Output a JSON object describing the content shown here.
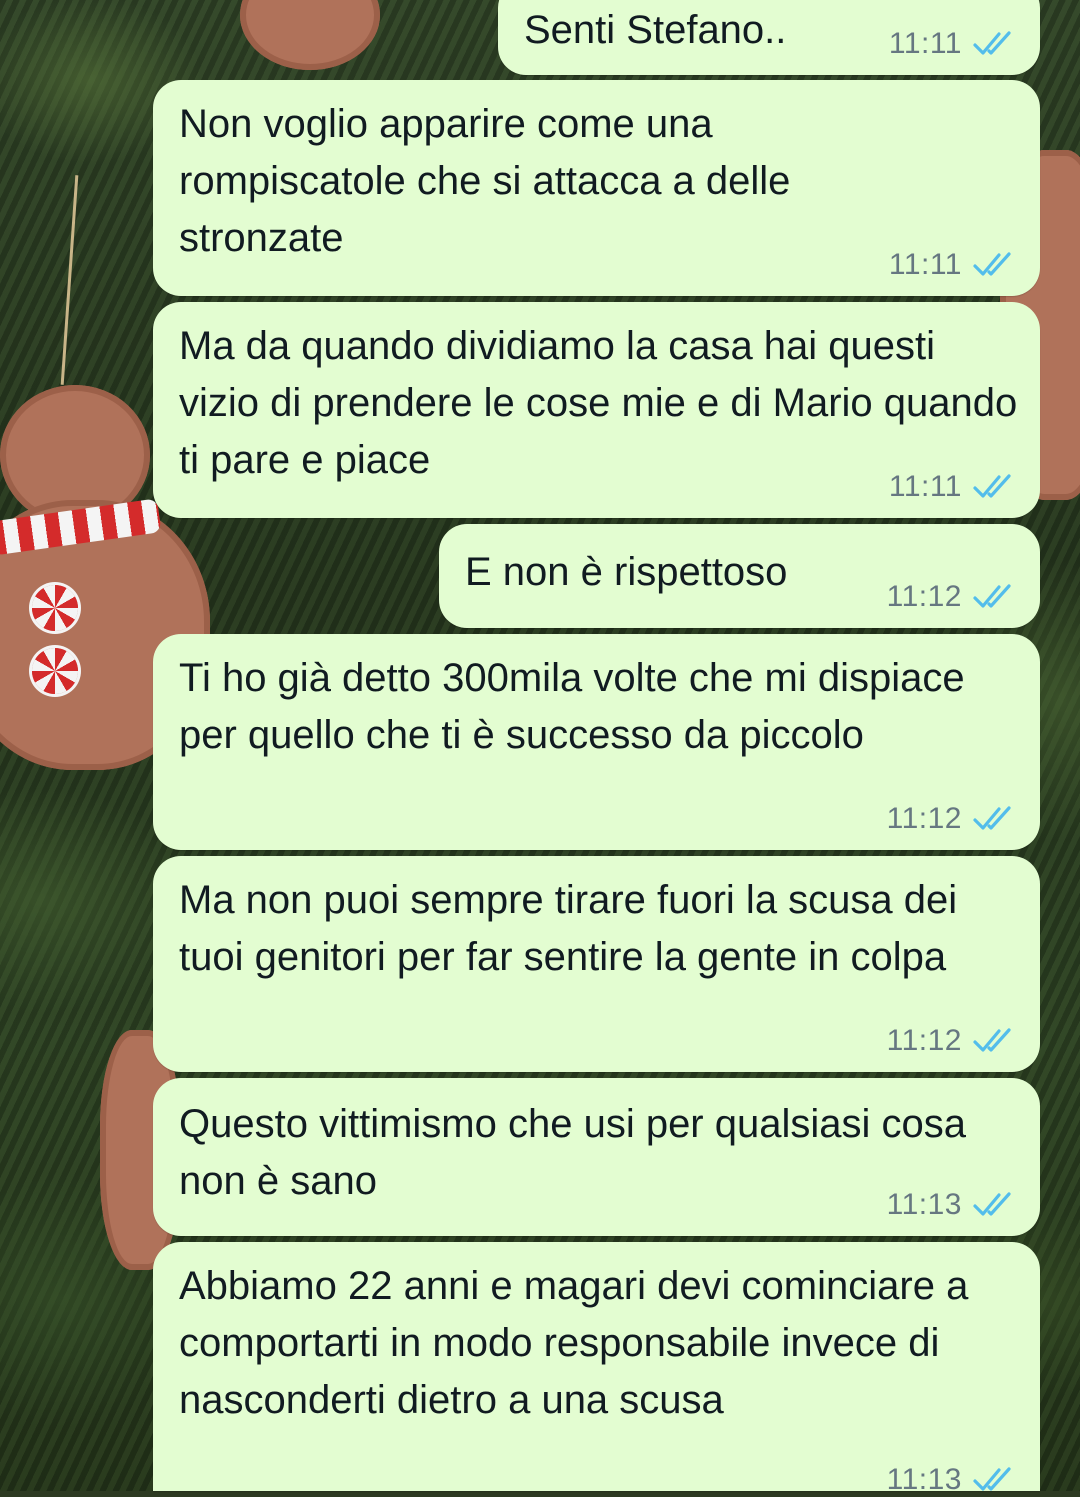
{
  "chat": {
    "messages": [
      {
        "text": "Senti Stefano..",
        "time": "11:11",
        "status": "read"
      },
      {
        "text": "Non voglio apparire come una rompiscatole che si attacca a delle stronzate",
        "time": "11:11",
        "status": "read"
      },
      {
        "text": "Ma da quando dividiamo la casa hai questi vizio di prendere le cose mie e di Mario quando ti pare e piace",
        "time": "11:11",
        "status": "read"
      },
      {
        "text": "E non è rispettoso",
        "time": "11:12",
        "status": "read"
      },
      {
        "text": "Ti ho già detto 300mila volte che mi dispiace per quello che ti è successo da piccolo",
        "time": "11:12",
        "status": "read"
      },
      {
        "text": "Ma non puoi sempre tirare fuori la scusa dei tuoi genitori per far sentire la gente in colpa",
        "time": "11:12",
        "status": "read"
      },
      {
        "text": "Questo vittimismo che usi per qualsiasi cosa non è sano",
        "time": "11:13",
        "status": "read"
      },
      {
        "text": "Abbiamo 22 anni e magari devi cominciare a comportarti in modo responsabile invece di nasconderti dietro a una scusa",
        "time": "11:13",
        "status": "read"
      }
    ]
  },
  "colors": {
    "bubble_outgoing": "#e3fdd1",
    "text": "#111b21",
    "time": "#667781",
    "read_ticks": "#53bdeb"
  },
  "icons": {
    "read_receipt": "double-check-icon"
  }
}
